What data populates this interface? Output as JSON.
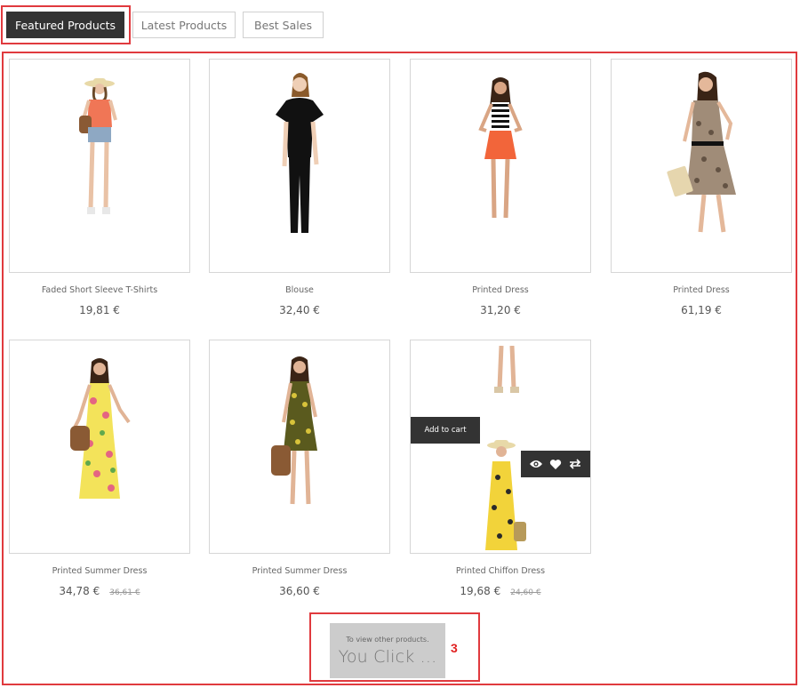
{
  "tabs": [
    {
      "label": "Featured Products",
      "active": true
    },
    {
      "label": "Latest Products",
      "active": false
    },
    {
      "label": "Best Sales",
      "active": false
    }
  ],
  "products": [
    {
      "name": "Faded Short Sleeve T-Shirts",
      "price": "19,81 €",
      "old_price": ""
    },
    {
      "name": "Blouse",
      "price": "32,40 €",
      "old_price": ""
    },
    {
      "name": "Printed Dress",
      "price": "31,20 €",
      "old_price": ""
    },
    {
      "name": "Printed Dress",
      "price": "61,19 €",
      "old_price": ""
    },
    {
      "name": "Printed Summer Dress",
      "price": "34,78 €",
      "old_price": "36,61 €"
    },
    {
      "name": "Printed Summer Dress",
      "price": "36,60 €",
      "old_price": ""
    },
    {
      "name": "Printed Chiffon Dress",
      "price": "19,68 €",
      "old_price": "24,60 €"
    }
  ],
  "hover_actions": {
    "add_to_cart": "Add to cart",
    "icons": [
      "eye-icon",
      "heart-icon",
      "compare-icon"
    ]
  },
  "view_more": {
    "hint": "To view other products.",
    "button": "You Click ...",
    "step": "3"
  },
  "colors": {
    "dark": "#333333",
    "highlight": "#e03a3e",
    "step": "#e02020",
    "view_more_bg": "#cccccc"
  }
}
